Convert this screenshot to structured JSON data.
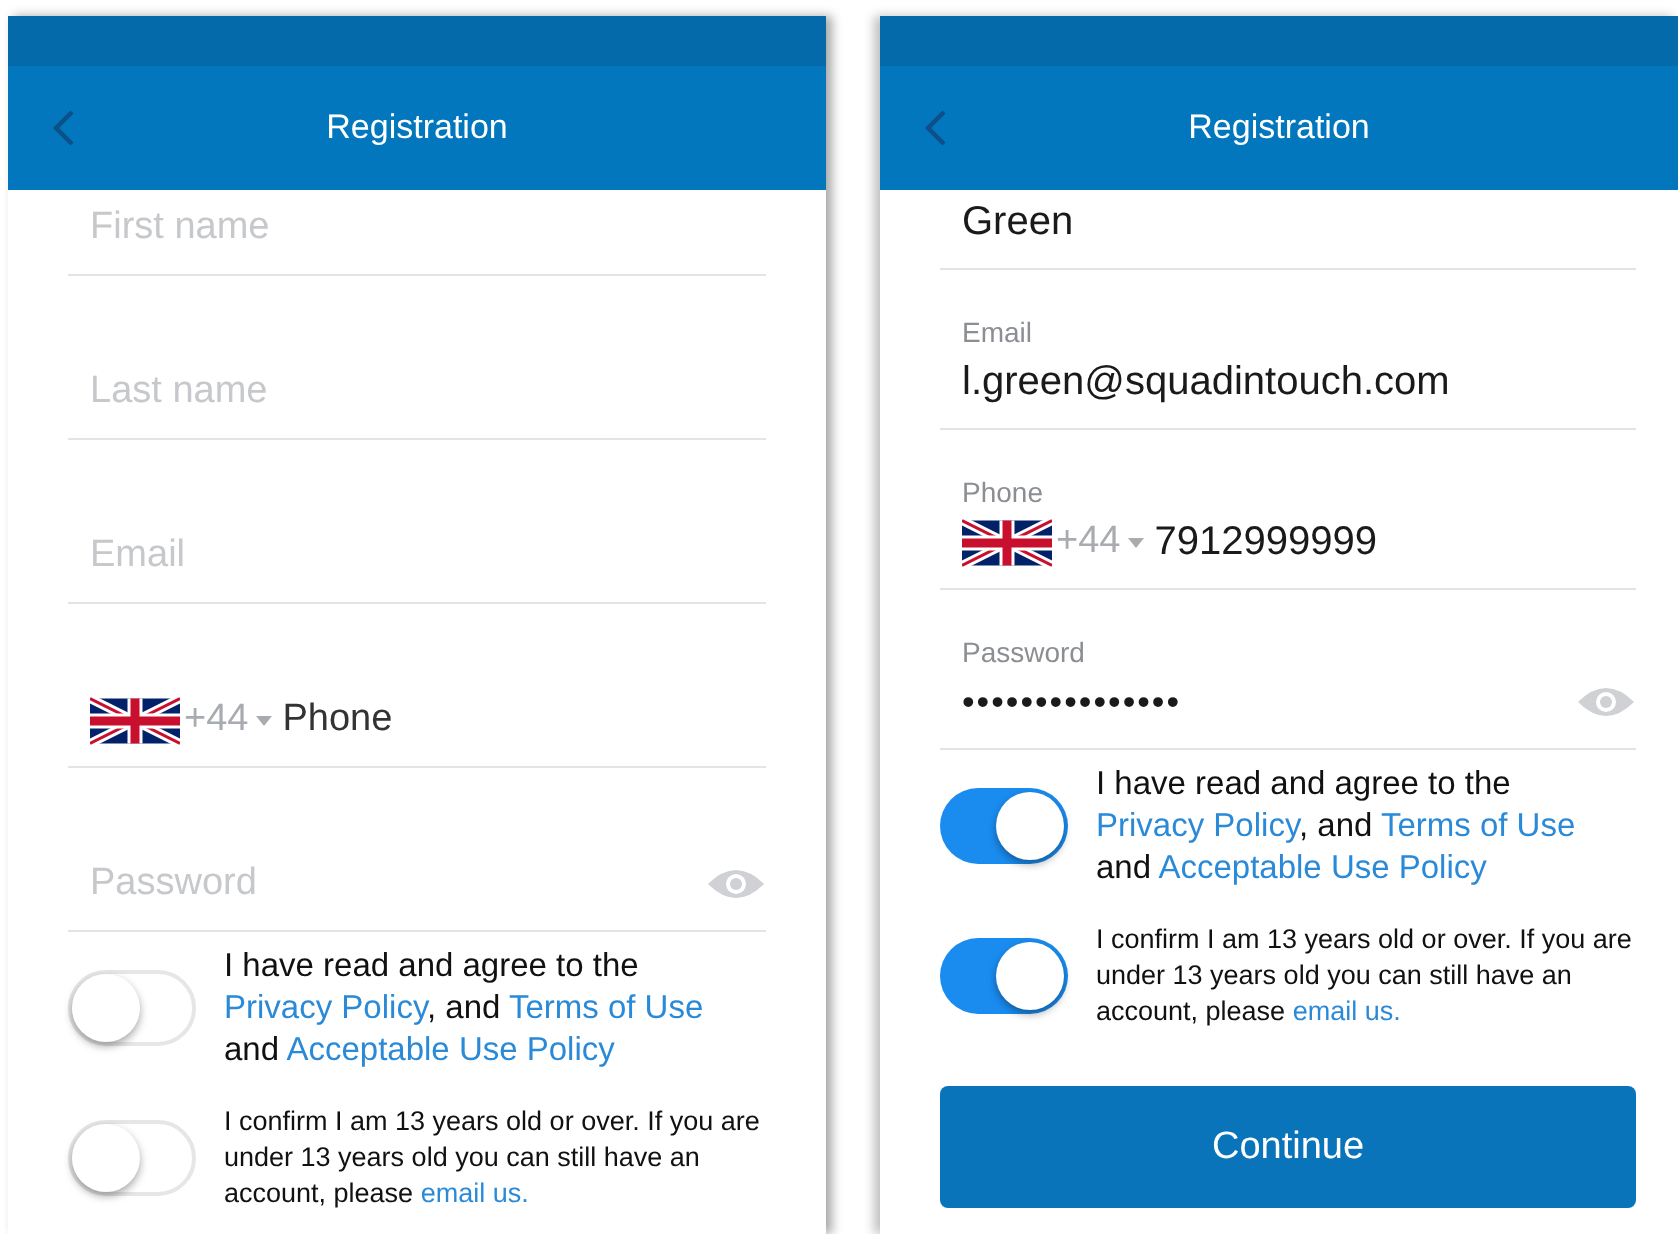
{
  "screens": [
    {
      "title": "Registration",
      "fields": [
        {
          "kind": "text",
          "placeholder": "First name"
        },
        {
          "kind": "text",
          "placeholder": "Last name"
        },
        {
          "kind": "text",
          "placeholder": "Email"
        },
        {
          "kind": "phone",
          "code": "+44",
          "placeholder": "Phone"
        },
        {
          "kind": "password",
          "placeholder": "Password"
        }
      ],
      "agreements": [
        {
          "kind": "terms",
          "on": false,
          "parts": [
            {
              "text": "I have read and agree to the ",
              "link": false
            },
            {
              "text": "Privacy Policy",
              "link": true
            },
            {
              "text": ", and ",
              "link": false
            },
            {
              "text": "Terms of Use",
              "link": true
            },
            {
              "text": " and ",
              "link": false
            },
            {
              "text": "Acceptable Use Policy",
              "link": true
            }
          ]
        },
        {
          "kind": "age",
          "on": false,
          "parts": [
            {
              "text": "I confirm I am 13 years old or over. If you are under 13 years old you can still have an account, please ",
              "link": false
            },
            {
              "text": "email us.",
              "link": true
            }
          ]
        }
      ]
    },
    {
      "title": "Registration",
      "fields": [
        {
          "kind": "text",
          "value": "Green"
        },
        {
          "kind": "text",
          "label": "Email",
          "value": "l.green@squadintouch.com"
        },
        {
          "kind": "phone",
          "label": "Phone",
          "code": "+44",
          "value": "7912999999"
        },
        {
          "kind": "password",
          "label": "Password",
          "value": "•••••••••••••••"
        }
      ],
      "agreements": [
        {
          "kind": "terms",
          "on": true,
          "parts": [
            {
              "text": "I have read and agree to the ",
              "link": false
            },
            {
              "text": "Privacy Policy",
              "link": true
            },
            {
              "text": ", and ",
              "link": false
            },
            {
              "text": "Terms of Use",
              "link": true
            },
            {
              "text": " and ",
              "link": false
            },
            {
              "text": "Acceptable Use Policy",
              "link": true
            }
          ]
        },
        {
          "kind": "age",
          "on": true,
          "parts": [
            {
              "text": "I confirm I am 13 years old or over. If you are under 13 years old you can still have an account, please ",
              "link": false
            },
            {
              "text": "email us.",
              "link": true
            }
          ]
        }
      ],
      "button": "Continue"
    }
  ]
}
